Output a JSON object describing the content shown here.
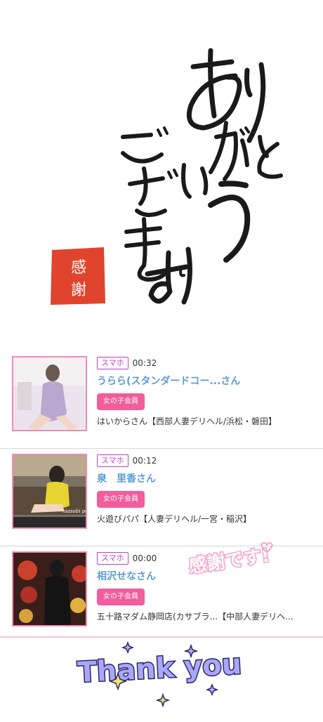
{
  "hero": {
    "calligraphy_text": "ありがとうございます",
    "seal_text": "感謝"
  },
  "entries": [
    {
      "device": "スマホ",
      "time": "00:32",
      "name": "うらら(スタンダードコー...さん",
      "member_badge": "女の子会員",
      "shop": "はいからさん【西部人妻デリヘル/浜松・磐田】"
    },
    {
      "device": "スマホ",
      "time": "00:12",
      "name": "泉　里香さん",
      "member_badge": "女の子会員",
      "shop": "火遊びパパ【人妻デリヘル/一宮・稲沢】",
      "thumb_watermark": "hiasobi papa"
    },
    {
      "device": "スマホ",
      "time": "00:00",
      "name": "相沢せなさん",
      "member_badge": "女の子会員",
      "shop": "五十路マダム静岡店(カサブラ...【中部人妻デリヘ...",
      "sticker_text": "感謝です!"
    }
  ],
  "footer": {
    "thank_you_text": "Thank you"
  },
  "colors": {
    "pink_border": "#f08cb4",
    "device_purple": "#c13ec2",
    "name_blue": "#5b9bd5",
    "badge_pink": "#f25d9c",
    "seal_red": "#e0442c",
    "thank_purple": "#8c8cf0"
  }
}
